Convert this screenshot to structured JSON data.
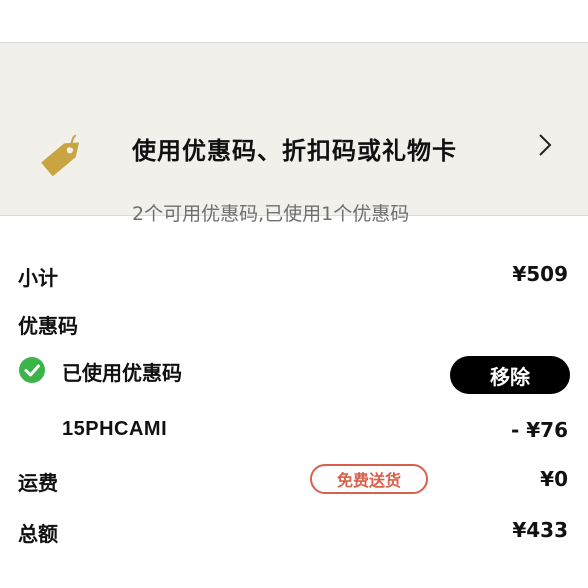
{
  "coupon_panel": {
    "title": "使用优惠码、折扣码或礼物卡",
    "subtitle": "2个可用优惠码,已使用1个优惠码"
  },
  "summary": {
    "subtotal_label": "小计",
    "subtotal_value": "¥509",
    "promo_label": "优惠码",
    "applied_label": "已使用优惠码",
    "remove_label": "移除",
    "promo_code": "15PHCAMI",
    "discount_value": "- ¥76",
    "shipping_label": "运费",
    "shipping_badge": "免费送货",
    "shipping_value": "¥0",
    "total_label": "总额",
    "total_value": "¥433"
  },
  "colors": {
    "panel_bg": "#f1f0ea",
    "tag_gold": "#c9a441",
    "check_green": "#3bb54a",
    "badge_red": "#d9604c"
  },
  "icons": [
    "price-tag-icon",
    "chevron-right-icon",
    "check-circle-icon"
  ]
}
